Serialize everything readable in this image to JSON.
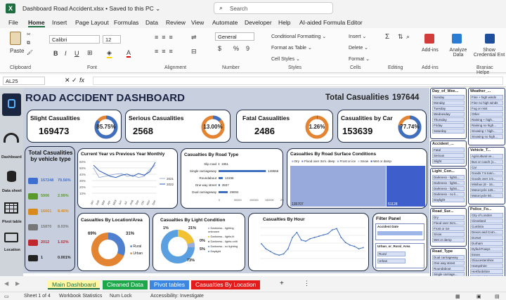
{
  "window": {
    "title": "Dashboard Road Accident.xlsx  •  Saved to this PC ⌄",
    "search_placeholder": "Search"
  },
  "menu": [
    "File",
    "Home",
    "Insert",
    "Page Layout",
    "Formulas",
    "Data",
    "Review",
    "View",
    "Automate",
    "Developer",
    "Help",
    "AI-aided Formula Editor"
  ],
  "ribbon": {
    "paste": "Paste",
    "font_name": "Calibri",
    "font_size": "12",
    "number_format": "General",
    "cond_format": "Conditional Formatting ⌄",
    "format_table": "Format as Table ⌄",
    "cell_styles": "Cell Styles ⌄",
    "insert": "Insert ⌄",
    "delete": "Delete ⌄",
    "format": "Format ⌄",
    "addins": "Add-ins",
    "analyze": "Analyze Data",
    "show_cred": "Show Credential Ent",
    "groups": [
      "Clipboard",
      "Font",
      "Alignment",
      "Number",
      "Styles",
      "Cells",
      "Editing",
      "Add-ins",
      "Braniac Helpe"
    ]
  },
  "formula_bar": {
    "name_box": "AL25",
    "fx": "fx"
  },
  "dashboard": {
    "title": "ROAD ACCIDENT DASHBOARD",
    "total_label": "Total Casualities",
    "total_value": "197644",
    "kpis": [
      {
        "label": "Slight Casualities",
        "value": "169473",
        "pct": "85.75%",
        "frac": 0.8575
      },
      {
        "label": "Serious Casualities",
        "value": "2568",
        "pct": "13.00%",
        "frac": 0.13
      },
      {
        "label": "Fatal Casualities",
        "value": "2486",
        "pct": "1.26%",
        "frac": 0.0126
      },
      {
        "label": "Casualities by Car",
        "value": "153639",
        "pct": "77.74%",
        "frac": 0.7774
      }
    ],
    "vehicle": {
      "title": "Total Casualities by vehicle type",
      "rows": [
        {
          "v": "157248",
          "p": "79.56%",
          "c": "#3d6fd1"
        },
        {
          "v": "5906",
          "p": "2.99%",
          "c": "#5a9a2a"
        },
        {
          "v": "16601",
          "p": "8.40%",
          "c": "#d98a1c"
        },
        {
          "v": "15870",
          "p": "8.03%",
          "c": "#777"
        },
        {
          "v": "2012",
          "p": "1.02%",
          "c": "#c0282d"
        },
        {
          "v": "1",
          "p": "0.001%",
          "c": "#222"
        }
      ]
    },
    "monthly": {
      "title": "Current Year vs Previous Year Monthly",
      "ylabels": [
        "60%",
        "50%",
        "40%",
        "30%",
        "20%",
        "10%"
      ],
      "months": [
        "Jan",
        "Feb",
        "Mar",
        "Apr",
        "May",
        "Jun",
        "Jul",
        "Aug",
        "Sep",
        "Oct",
        "Nov",
        "Dec"
      ],
      "legend": [
        "2021",
        "2022"
      ]
    },
    "road": {
      "title": "Casualties By Road Type",
      "rows": [
        {
          "l": "Slip road",
          "v": "1951"
        },
        {
          "l": "Single carriageway",
          "v": "149556"
        },
        {
          "l": "Roundabout",
          "v": "13196"
        },
        {
          "l": "One way street",
          "v": "3937"
        },
        {
          "l": "Dual carriageway",
          "v": "29004"
        }
      ],
      "axis": [
        "0",
        "50000",
        "100000",
        "150000",
        "200000"
      ]
    },
    "surface": {
      "title": "Casualties By Road Surface Conditions",
      "legend": [
        "Dry",
        "Flood over 3cm. deep",
        "Frost or ice",
        "Snow",
        "Wet or damp"
      ],
      "vals": [
        "135707",
        "51128"
      ]
    },
    "location": {
      "title": "Casualties By Location/Area",
      "p1": "69%",
      "p2": "31%",
      "legend": [
        "Rural",
        "Urban"
      ]
    },
    "light": {
      "title": "Casualties By Light Condition",
      "pcts": [
        "1%",
        "21%",
        "0%",
        "5%",
        "73%"
      ],
      "legend": [
        "Darkness - lighting unknown",
        "Darkness - lights lit",
        "Darkness - lights unlit",
        "Darkness - no lighting",
        "Daylight"
      ]
    },
    "hour": {
      "title": "Casualties By Hour"
    },
    "filter": {
      "title": "Filter Panel",
      "f1": "Accident Date",
      "f2": "Urban_or_Rural_Area",
      "opts": [
        "Rural",
        "Urban"
      ]
    },
    "side_labels": [
      "Dashboard",
      "Data sheet",
      "Pivot table",
      "Location"
    ]
  },
  "slicers": {
    "col1": [
      {
        "t": "Day_of_Wee...",
        "items": [
          "Sunday",
          "Monday",
          "Tuesday",
          "Wednesday",
          "Thursday",
          "Friday",
          "Saturday"
        ]
      },
      {
        "t": "Accident_...",
        "items": [
          "Fatal",
          "Serious",
          "Slight"
        ]
      },
      {
        "t": "Light_Con...",
        "items": [
          "Darkness - lights...",
          "Darkness - lights...",
          "Darkness - lights...",
          "Darkness - no li...",
          "Daylight"
        ]
      },
      {
        "t": "Road_Sur...",
        "items": [
          "Dry",
          "Flood over 3cm...",
          "Frost or ice",
          "Snow",
          "Wet or damp"
        ]
      },
      {
        "t": "Road_Type",
        "items": [
          "Dual carriageway",
          "One way street",
          "Roundabout",
          "Single carriage...",
          "Slip road"
        ]
      }
    ],
    "col2": [
      {
        "t": "Weather_...",
        "items": [
          "Fine + high winds",
          "Fine no high winds",
          "Fog or mist",
          "Other",
          "Raining + high...",
          "Raining no high...",
          "Snowing + high...",
          "Snowing no high..."
        ]
      },
      {
        "t": "Vehicle_T...",
        "items": [
          "Agricultural ve...",
          "Bus or coach (1...",
          "Car",
          "Goods 7.5 tonn...",
          "Goods over 3.5...",
          "Minibus (8 - 16...",
          "Motorcycle 125...",
          "Motorcycle 50..."
        ]
      },
      {
        "t": "Police_Fo...",
        "items": [
          "City of London",
          "Cleveland",
          "Cumbria",
          "Devon and Corn...",
          "Dorset",
          "Durham",
          "Dyfed-Powys",
          "Essex",
          "Gloucestershire",
          "Hampshire",
          "Hertfordshire",
          "Humberside"
        ]
      }
    ]
  },
  "sheet_tabs": [
    "Main Dashboard",
    "Cleaned Data",
    "Pivot tables",
    "Casualties By Location"
  ],
  "status": {
    "sheet": "Sheet 1 of 4",
    "workbook": "Workbook Statistics",
    "numlock": "Num Lock",
    "access": "Accessibility: Investigate"
  }
}
